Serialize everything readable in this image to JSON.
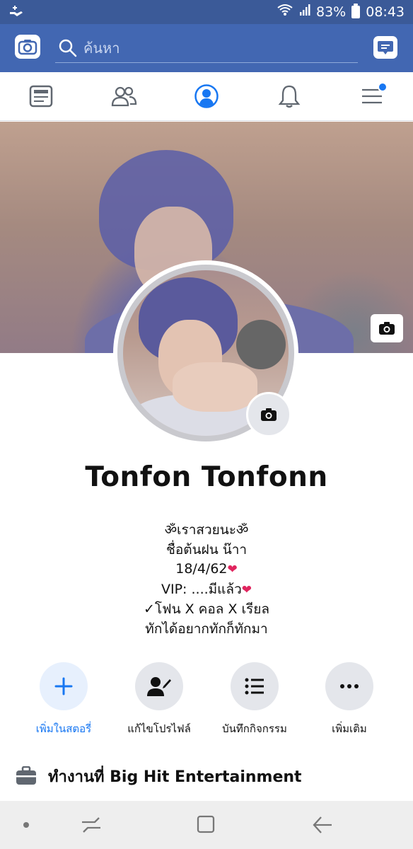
{
  "status_bar": {
    "battery": "83%",
    "time": "08:43"
  },
  "search": {
    "placeholder": "ค้นหา"
  },
  "tabs": [
    "news-feed",
    "friends",
    "profile",
    "notifications",
    "menu"
  ],
  "profile": {
    "name": "Tonfon Tonfonn",
    "bio": [
      "ॐเราสวยนะॐ",
      "ชื่อต้นฝน น๊าา",
      "18/4/62",
      "VIP: ....มีแล้ว",
      "✓โฟน X คอล X เรียล",
      "ทักได้อยากทักก็ทักมา"
    ]
  },
  "actions": [
    {
      "label": "เพิ่มในสตอรี่",
      "icon": "plus-icon"
    },
    {
      "label": "แก้ไขโปรไฟล์",
      "icon": "edit-profile-icon"
    },
    {
      "label": "บันทึกกิจกรรม",
      "icon": "list-icon"
    },
    {
      "label": "เพิ่มเติม",
      "icon": "more-icon"
    }
  ],
  "work": {
    "text": "ทำงานที่ Big Hit Entertainment"
  },
  "colors": {
    "brand": "#4267b2",
    "status": "#3b5a98",
    "accent": "#1877f2"
  }
}
